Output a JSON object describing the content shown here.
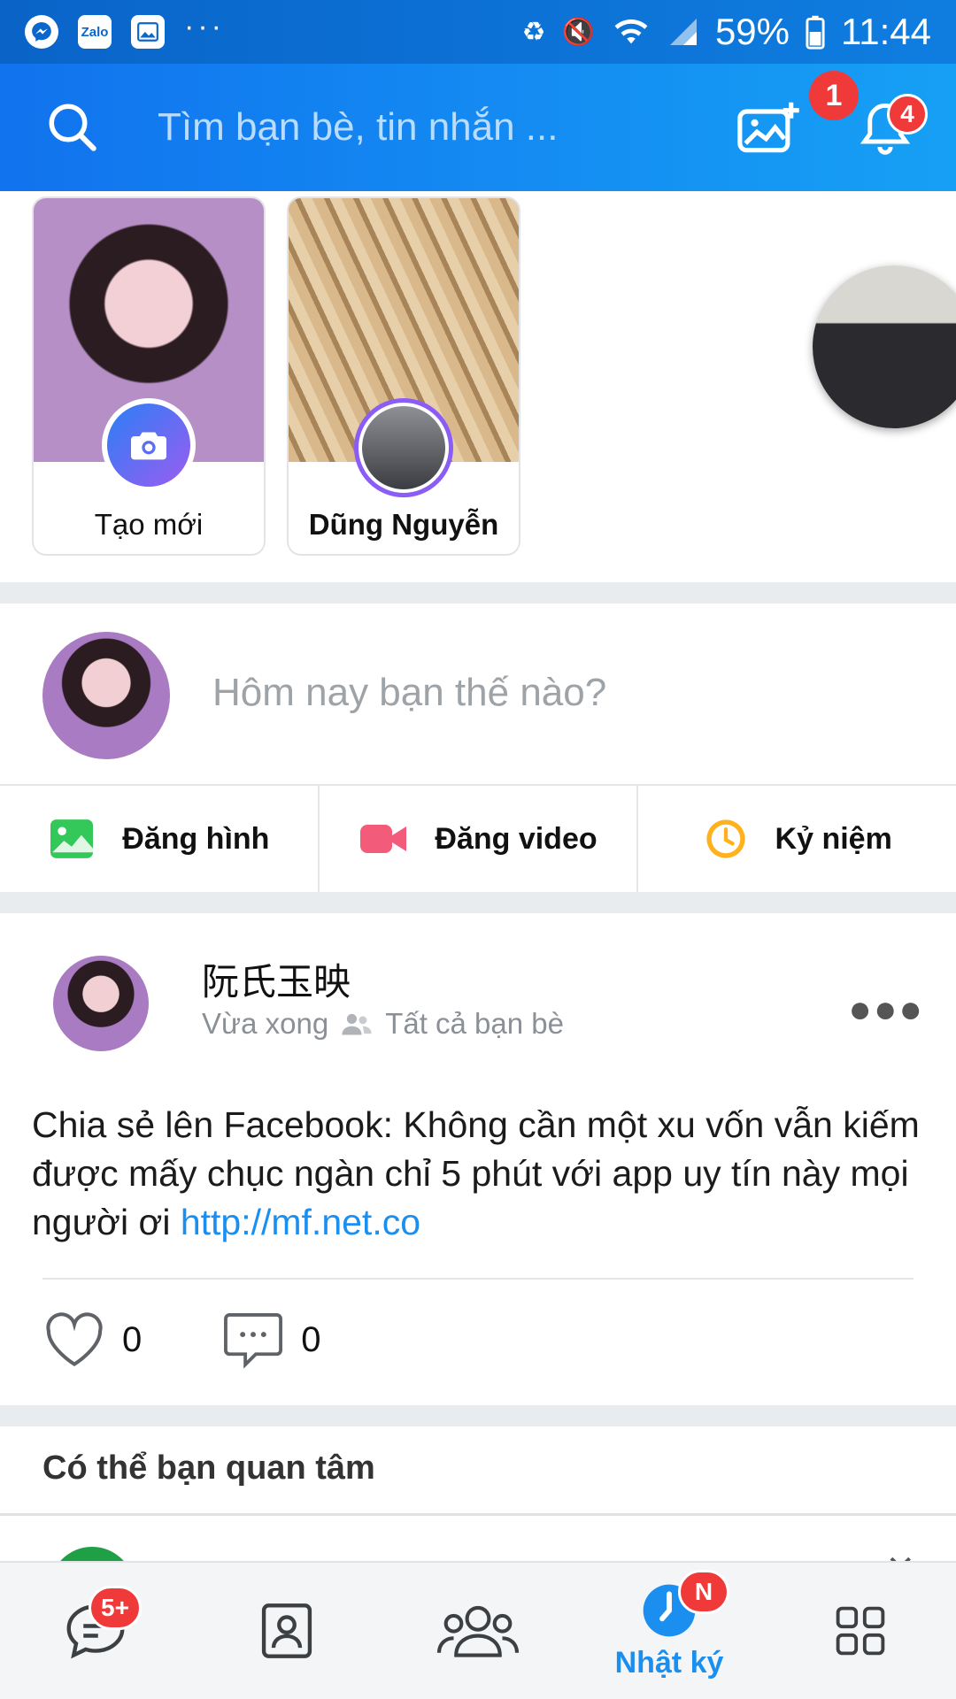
{
  "status_bar": {
    "app_icons": [
      "messenger-icon",
      "zalo-icon",
      "gallery-icon"
    ],
    "zalo_label": "Zalo",
    "more": "···",
    "battery": "59%",
    "time": "11:44"
  },
  "header": {
    "search_placeholder": "Tìm bạn bè, tin nhắn ...",
    "notification_count": "4"
  },
  "stories": {
    "items": [
      {
        "label": "Tạo mới"
      },
      {
        "label": "Dũng Nguyễn"
      }
    ],
    "floating_badge": "1"
  },
  "composer": {
    "placeholder": "Hôm nay bạn thế nào?",
    "actions": [
      {
        "label": "Đăng hình",
        "icon": "image-icon"
      },
      {
        "label": "Đăng video",
        "icon": "video-icon"
      },
      {
        "label": "Kỷ niệm",
        "icon": "clock-icon"
      }
    ]
  },
  "post": {
    "author": "阮氏玉映",
    "time": "Vừa xong",
    "privacy": "Tất cả bạn bè",
    "text": "Chia sẻ lên Facebook: Không cần một xu vốn vẫn kiếm được mấy chục ngàn chỉ 5 phút với app uy tín này mọi người ơi ",
    "link": "http://mf.net.co",
    "likes": "0",
    "comments": "0"
  },
  "suggestions": {
    "title": "Có thể bạn quan tâm"
  },
  "bottom_nav": {
    "messages_badge": "5+",
    "timeline_badge": "N",
    "timeline_label": "Nhật ký",
    "accent": "#1b8ff0"
  }
}
